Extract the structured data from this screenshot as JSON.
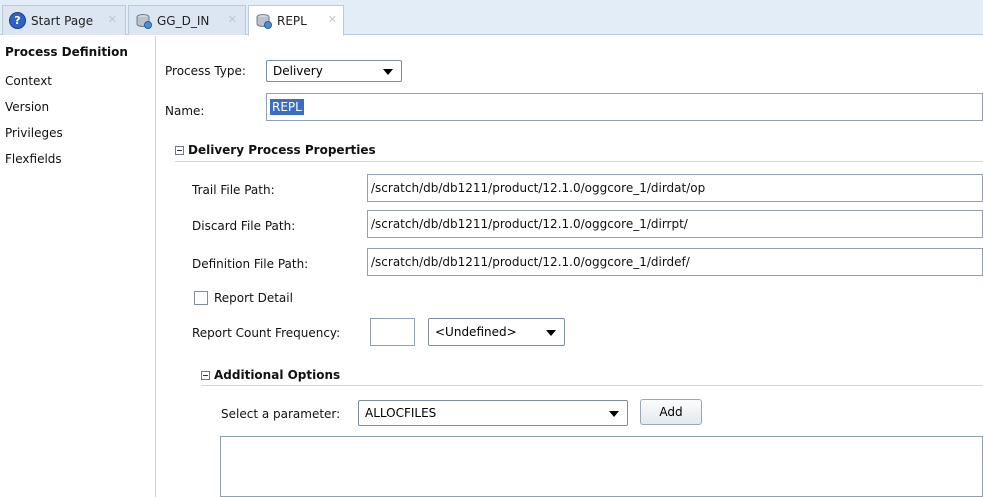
{
  "tabs": [
    {
      "label": "Start Page",
      "icon": "help-icon"
    },
    {
      "label": "GG_D_IN",
      "icon": "database-process-icon"
    },
    {
      "label": "REPL",
      "icon": "database-process-icon"
    }
  ],
  "sidebar": {
    "items": [
      {
        "label": "Process Definition",
        "active": true
      },
      {
        "label": "Context"
      },
      {
        "label": "Version"
      },
      {
        "label": "Privileges"
      },
      {
        "label": "Flexfields"
      }
    ]
  },
  "form": {
    "process_type_label": "Process Type:",
    "process_type_value": "Delivery",
    "name_label": "Name:",
    "name_value": "REPL"
  },
  "delivery": {
    "section_title": "Delivery Process Properties",
    "trail_label": "Trail File Path:",
    "trail_value": "/scratch/db/db1211/product/12.1.0/oggcore_1/dirdat/op",
    "discard_label": "Discard File Path:",
    "discard_value": "/scratch/db/db1211/product/12.1.0/oggcore_1/dirrpt/",
    "definition_label": "Definition File Path:",
    "definition_value": "/scratch/db/db1211/product/12.1.0/oggcore_1/dirdef/",
    "report_detail_label": "Report Detail",
    "report_detail_checked": false,
    "report_count_label": "Report Count Frequency:",
    "report_count_value": "",
    "report_count_unit": "<Undefined>"
  },
  "additional": {
    "section_title": "Additional Options",
    "select_param_label": "Select a parameter:",
    "select_param_value": "ALLOCFILES",
    "add_button": "Add"
  },
  "colors": {
    "tabbar_bg": "#e3edf7",
    "selection": "#3a6ec1"
  }
}
